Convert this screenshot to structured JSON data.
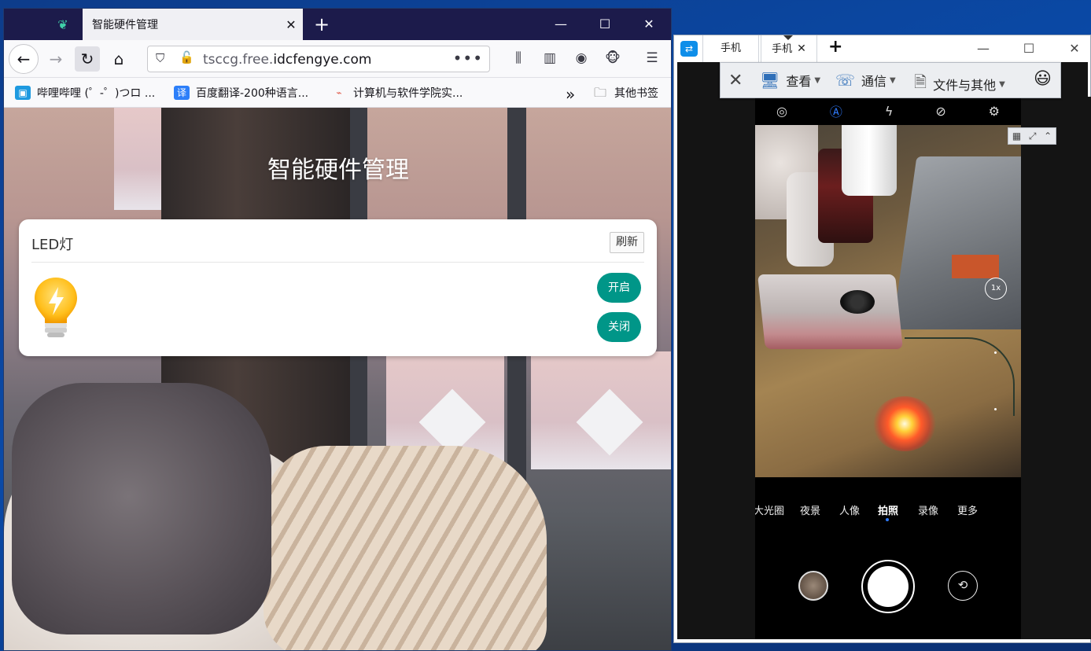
{
  "browser": {
    "tab_title": "智能硬件管理",
    "tab_close": "✕",
    "new_tab": "+",
    "url_host_prefix": "tsccg.free.",
    "url_host_main": "idcfengye.com",
    "url_more": "•••",
    "window_controls": {
      "minimize": "—",
      "maximize": "☐",
      "close": "✕"
    },
    "bookmarks": [
      {
        "label": "哔哩哔哩 (゜-゜)つロ ...",
        "icon": "bilibili-icon",
        "color": "#1e9ae0"
      },
      {
        "label": "百度翻译-200种语言...",
        "icon": "baidu-translate-icon",
        "color": "#2d7ff9"
      },
      {
        "label": "计算机与软件学院实...",
        "icon": "link-icon",
        "color": "#e05a4a"
      }
    ],
    "bookmarks_overflow": "»",
    "other_bookmarks": "其他书签"
  },
  "page": {
    "title": "智能硬件管理",
    "card": {
      "title": "LED灯",
      "refresh_label": "刷新",
      "on_label": "开启",
      "off_label": "关闭"
    },
    "accent_color": "#009688"
  },
  "teamviewer": {
    "tabs": [
      {
        "label": "手机"
      },
      {
        "label": "手机",
        "close": "✕"
      }
    ],
    "new_tab": "+",
    "toolbar": {
      "close": "✕",
      "view_label": "查看",
      "comm_label": "通信",
      "files_label": "文件与其他",
      "emoji": "😃"
    },
    "window_controls": {
      "minimize": "—",
      "maximize": "☐",
      "close": "✕"
    }
  },
  "camera": {
    "zoom": "1x",
    "modes": [
      "大光圈",
      "夜景",
      "人像",
      "拍照",
      "录像",
      "更多"
    ],
    "active_mode": "拍照"
  }
}
